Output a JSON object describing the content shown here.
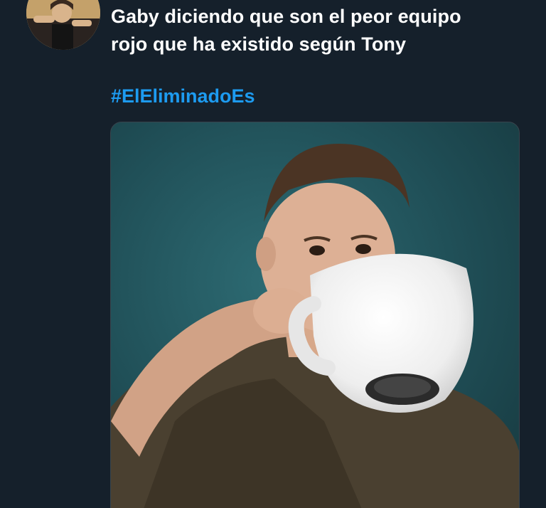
{
  "tweet": {
    "text_lines": [
      "Gaby diciendo que son el peor equipo",
      "rojo que ha existido según Tony"
    ],
    "hashtag": "#ElEliminadoEs"
  },
  "avatar": {
    "icon": "user-avatar-photo"
  },
  "media": {
    "icon": "photo-man-drinking-from-giant-cup"
  },
  "colors": {
    "background": "#15202b",
    "text": "#ffffff",
    "link": "#1d9bf0"
  }
}
